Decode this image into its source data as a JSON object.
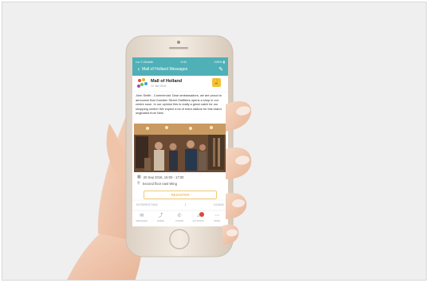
{
  "app": {
    "status_bar": {
      "left": "•••• T-Mobile",
      "time": "9:41",
      "right": "100% ▮"
    },
    "nav": {
      "title": "Mall of Holland Messages",
      "back_icon": "chevron-left-icon",
      "edit_icon": "pencil-icon"
    },
    "post": {
      "brand": "Mall of Holland",
      "subtitle": "12 Jan 2016",
      "badge_icon": "trophy-icon",
      "message": "John Smith - Commercial: Dear ambassadors, we are proud to announce that Camden Street Outfitters opens a shop in our centre soon. In our opinion this is really a great catch for our shopping centre! We expect a lot of extra visitors for this brand originated from New",
      "date_line": "20 Sep 2016, 15:00 - 17:00",
      "location_line": "Second floor east Wing",
      "register_label": "REGISTER",
      "rsvp_left": "INTERESTING",
      "rsvp_mid": "1",
      "rsvp_right": "GOING"
    },
    "tabbar": [
      {
        "label": "MESSAGES",
        "icon": "envelope-icon"
      },
      {
        "label": "SHARE",
        "icon": "share-icon"
      },
      {
        "label": "FORUM",
        "icon": "phone-icon"
      },
      {
        "label": "ACTIVITIES",
        "icon": "bell-icon"
      },
      {
        "label": "MORE",
        "icon": "dots-icon"
      }
    ]
  },
  "colors": {
    "background": "#efefef",
    "header_teal": "#4fb0b7",
    "accent_orange": "#e9a23a",
    "badge_yellow": "#f2c230",
    "phone_gold": "#e8ddd0",
    "skin": "#f1c7ad"
  }
}
